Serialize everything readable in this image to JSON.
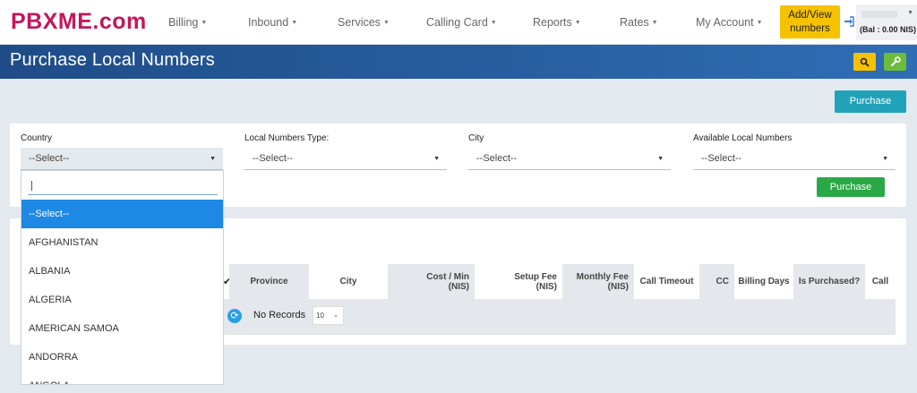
{
  "brand": {
    "logo_part1": "PBXME",
    "logo_part2": ".com"
  },
  "nav": {
    "items": [
      "Billing",
      "Inbound",
      "Services",
      "Calling Card",
      "Reports",
      "Rates",
      "My Account"
    ],
    "add_view": "Add/View numbers",
    "balance": "(Bal : 0.00 NIS)"
  },
  "page": {
    "title": "Purchase Local Numbers",
    "purchase_top": "Purchase",
    "purchase_button": "Purchase"
  },
  "filters": {
    "country_label": "Country",
    "country_value": "--Select--",
    "type_label": "Local Numbers Type:",
    "type_value": "--Select--",
    "city_label": "City",
    "city_value": "--Select--",
    "available_label": "Available Local Numbers",
    "available_value": "--Select--"
  },
  "dropdown": {
    "options": [
      "--Select--",
      "AFGHANISTAN",
      "ALBANIA",
      "ALGERIA",
      "AMERICAN SAMOA",
      "ANDORRA",
      "ANGOLA"
    ]
  },
  "table": {
    "headers": {
      "province": "Province",
      "city": "City",
      "cost_min": "Cost / Min (NIS)",
      "setup_fee": "Setup Fee (NIS)",
      "monthly_fee": "Monthly Fee (NIS)",
      "call_timeout": "Call Timeout",
      "cc": "CC",
      "billing_days": "Billing Days",
      "is_purchased": "Is Purchased?",
      "call": "Call"
    },
    "no_records": "No Records",
    "page_size": "10"
  },
  "colors": {
    "accent": "#1e88e5",
    "brand": "#c4165c",
    "warning": "#f6c200",
    "success": "#2aa846",
    "info": "#22a2b8"
  }
}
